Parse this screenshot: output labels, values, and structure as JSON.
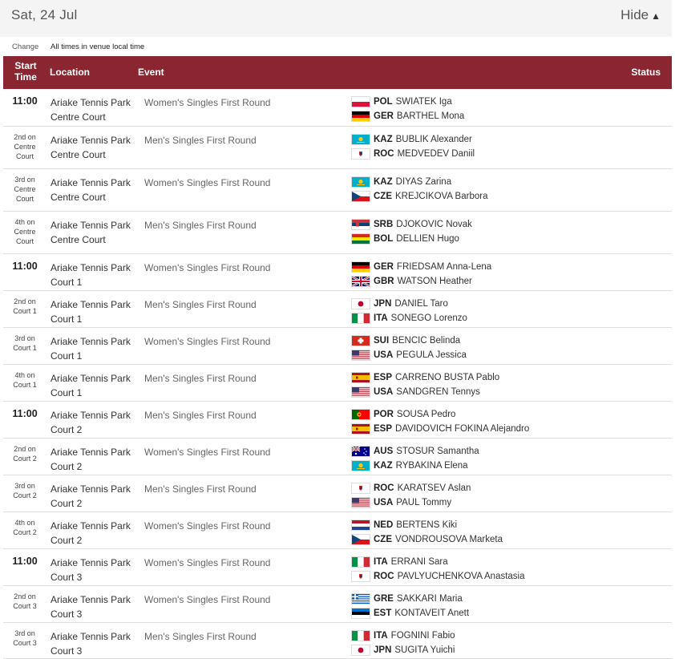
{
  "header": {
    "date": "Sat, 24 Jul",
    "hide_label": "Hide"
  },
  "subheader": {
    "change_label": "Change",
    "note": "All times in venue local time"
  },
  "columns": {
    "start": "Start Time",
    "location": "Location",
    "event": "Event",
    "status": "Status"
  },
  "flag_colors": {
    "POL": [
      "#ffffff",
      "#dc143c"
    ],
    "GER": [
      "#000000",
      "#dd0000",
      "#ffce00"
    ],
    "KAZ": [
      "#00afca"
    ],
    "ROC": [
      "#ffffff"
    ],
    "CZE": [
      "#ffffff",
      "#d7141a",
      "#11457e"
    ],
    "SRB": [
      "#c6363c",
      "#0c4076",
      "#ffffff"
    ],
    "BOL": [
      "#d52b1e",
      "#f9e300",
      "#007934"
    ],
    "GBR": [
      "#012169"
    ],
    "JPN": [
      "#ffffff",
      "#bc002d"
    ],
    "ITA": [
      "#009246",
      "#ffffff",
      "#ce2b37"
    ],
    "SUI": [
      "#d52b1e"
    ],
    "USA": [
      "#b22234",
      "#3c3b6e"
    ],
    "ESP": [
      "#aa151b",
      "#f1bf00"
    ],
    "POR": [
      "#006600",
      "#ff0000"
    ],
    "AUS": [
      "#00008b"
    ],
    "NED": [
      "#ae1c28",
      "#ffffff",
      "#21468b"
    ],
    "GRE": [
      "#0d5eaf",
      "#ffffff"
    ],
    "EST": [
      "#0072ce",
      "#000000",
      "#ffffff"
    ]
  },
  "matches": [
    {
      "time": "11:00",
      "time_small": false,
      "location": "Ariake Tennis Park",
      "court": "Centre Court",
      "event": "Women's Singles First Round",
      "players": [
        {
          "code": "POL",
          "name": "SWIATEK Iga"
        },
        {
          "code": "GER",
          "name": "BARTHEL Mona"
        }
      ]
    },
    {
      "time": "2nd on Centre Court",
      "time_small": true,
      "location": "Ariake Tennis Park",
      "court": "Centre Court",
      "event": "Men's Singles First Round",
      "players": [
        {
          "code": "KAZ",
          "name": "BUBLIK Alexander"
        },
        {
          "code": "ROC",
          "name": "MEDVEDEV Daniil"
        }
      ]
    },
    {
      "time": "3rd on Centre Court",
      "time_small": true,
      "location": "Ariake Tennis Park",
      "court": "Centre Court",
      "event": "Women's Singles First Round",
      "players": [
        {
          "code": "KAZ",
          "name": "DIYAS Zarina"
        },
        {
          "code": "CZE",
          "name": "KREJCIKOVA Barbora"
        }
      ]
    },
    {
      "time": "4th on Centre Court",
      "time_small": true,
      "location": "Ariake Tennis Park",
      "court": "Centre Court",
      "event": "Men's Singles First Round",
      "players": [
        {
          "code": "SRB",
          "name": "DJOKOVIC Novak"
        },
        {
          "code": "BOL",
          "name": "DELLIEN Hugo"
        }
      ]
    },
    {
      "time": "11:00",
      "time_small": false,
      "location": "Ariake Tennis Park",
      "court": "Court 1",
      "event": "Women's Singles First Round",
      "players": [
        {
          "code": "GER",
          "name": "FRIEDSAM Anna-Lena"
        },
        {
          "code": "GBR",
          "name": "WATSON Heather"
        }
      ]
    },
    {
      "time": "2nd on Court 1",
      "time_small": true,
      "location": "Ariake Tennis Park",
      "court": "Court 1",
      "event": "Men's Singles First Round",
      "players": [
        {
          "code": "JPN",
          "name": "DANIEL Taro"
        },
        {
          "code": "ITA",
          "name": "SONEGO Lorenzo"
        }
      ]
    },
    {
      "time": "3rd on Court 1",
      "time_small": true,
      "location": "Ariake Tennis Park",
      "court": "Court 1",
      "event": "Women's Singles First Round",
      "players": [
        {
          "code": "SUI",
          "name": "BENCIC Belinda"
        },
        {
          "code": "USA",
          "name": "PEGULA Jessica"
        }
      ]
    },
    {
      "time": "4th on Court 1",
      "time_small": true,
      "location": "Ariake Tennis Park",
      "court": "Court 1",
      "event": "Men's Singles First Round",
      "players": [
        {
          "code": "ESP",
          "name": "CARRENO BUSTA Pablo"
        },
        {
          "code": "USA",
          "name": "SANDGREN Tennys"
        }
      ]
    },
    {
      "time": "11:00",
      "time_small": false,
      "location": "Ariake Tennis Park",
      "court": "Court 2",
      "event": "Men's Singles First Round",
      "players": [
        {
          "code": "POR",
          "name": "SOUSA Pedro"
        },
        {
          "code": "ESP",
          "name": "DAVIDOVICH FOKINA Alejandro"
        }
      ]
    },
    {
      "time": "2nd on Court 2",
      "time_small": true,
      "location": "Ariake Tennis Park",
      "court": "Court 2",
      "event": "Women's Singles First Round",
      "players": [
        {
          "code": "AUS",
          "name": "STOSUR Samantha"
        },
        {
          "code": "KAZ",
          "name": "RYBAKINA Elena"
        }
      ]
    },
    {
      "time": "3rd on Court 2",
      "time_small": true,
      "location": "Ariake Tennis Park",
      "court": "Court 2",
      "event": "Men's Singles First Round",
      "players": [
        {
          "code": "ROC",
          "name": "KARATSEV Aslan"
        },
        {
          "code": "USA",
          "name": "PAUL Tommy"
        }
      ]
    },
    {
      "time": "4th on Court 2",
      "time_small": true,
      "location": "Ariake Tennis Park",
      "court": "Court 2",
      "event": "Women's Singles First Round",
      "players": [
        {
          "code": "NED",
          "name": "BERTENS Kiki"
        },
        {
          "code": "CZE",
          "name": "VONDROUSOVA Marketa"
        }
      ]
    },
    {
      "time": "11:00",
      "time_small": false,
      "location": "Ariake Tennis Park",
      "court": "Court 3",
      "event": "Women's Singles First Round",
      "players": [
        {
          "code": "ITA",
          "name": "ERRANI Sara"
        },
        {
          "code": "ROC",
          "name": "PAVLYUCHENKOVA Anastasia"
        }
      ]
    },
    {
      "time": "2nd on Court 3",
      "time_small": true,
      "location": "Ariake Tennis Park",
      "court": "Court 3",
      "event": "Women's Singles First Round",
      "players": [
        {
          "code": "GRE",
          "name": "SAKKARI Maria"
        },
        {
          "code": "EST",
          "name": "KONTAVEIT Anett"
        }
      ]
    },
    {
      "time": "3rd on Court 3",
      "time_small": true,
      "location": "Ariake Tennis Park",
      "court": "Court 3",
      "event": "Men's Singles First Round",
      "players": [
        {
          "code": "ITA",
          "name": "FOGNINI Fabio"
        },
        {
          "code": "JPN",
          "name": "SUGITA Yuichi"
        }
      ]
    }
  ]
}
